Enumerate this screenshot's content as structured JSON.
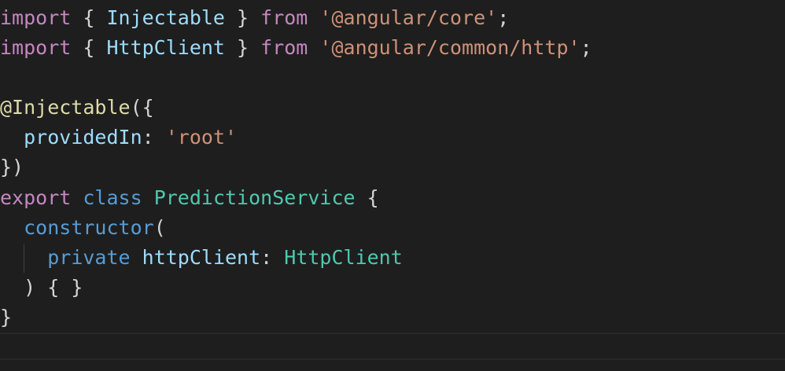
{
  "editor": {
    "lines": [
      {
        "tokens": [
          [
            "kw-ctrl",
            "import"
          ],
          [
            "punc",
            " { "
          ],
          [
            "var",
            "Injectable"
          ],
          [
            "punc",
            " } "
          ],
          [
            "kw-ctrl",
            "from"
          ],
          [
            "punc",
            " "
          ],
          [
            "str",
            "'@angular/core'"
          ],
          [
            "punc",
            ";"
          ]
        ]
      },
      {
        "tokens": [
          [
            "kw-ctrl",
            "import"
          ],
          [
            "punc",
            " { "
          ],
          [
            "var",
            "HttpClient"
          ],
          [
            "punc",
            " } "
          ],
          [
            "kw-ctrl",
            "from"
          ],
          [
            "punc",
            " "
          ],
          [
            "str",
            "'@angular/common/http'"
          ],
          [
            "punc",
            ";"
          ]
        ]
      },
      {
        "tokens": []
      },
      {
        "tokens": [
          [
            "fn",
            "@Injectable"
          ],
          [
            "punc",
            "({"
          ]
        ]
      },
      {
        "tokens": [
          [
            "punc",
            "  "
          ],
          [
            "var",
            "providedIn"
          ],
          [
            "punc",
            ": "
          ],
          [
            "str",
            "'root'"
          ]
        ]
      },
      {
        "tokens": [
          [
            "punc",
            "})"
          ]
        ]
      },
      {
        "tokens": [
          [
            "kw-ctrl",
            "export"
          ],
          [
            "punc",
            " "
          ],
          [
            "kw",
            "class"
          ],
          [
            "punc",
            " "
          ],
          [
            "type",
            "PredictionService"
          ],
          [
            "punc",
            " {"
          ]
        ]
      },
      {
        "tokens": [
          [
            "punc",
            "  "
          ],
          [
            "kw",
            "constructor"
          ],
          [
            "punc",
            "("
          ]
        ]
      },
      {
        "tokens": [
          [
            "punc",
            "    "
          ],
          [
            "kw",
            "private"
          ],
          [
            "punc",
            " "
          ],
          [
            "var",
            "httpClient"
          ],
          [
            "punc",
            ": "
          ],
          [
            "type",
            "HttpClient"
          ]
        ]
      },
      {
        "tokens": [
          [
            "punc",
            "  ) { }"
          ]
        ]
      },
      {
        "tokens": [
          [
            "punc",
            "}"
          ]
        ]
      }
    ]
  }
}
